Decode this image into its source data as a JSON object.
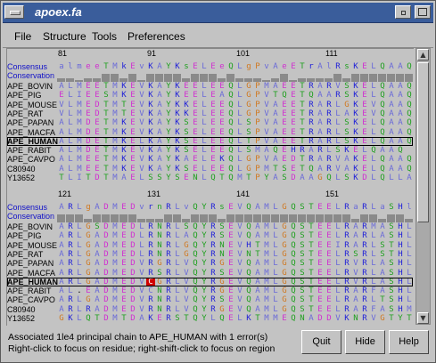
{
  "window": {
    "title": "apoex.fa"
  },
  "menu": [
    "File",
    "Structure",
    "Tools",
    "Preferences"
  ],
  "blocks": [
    {
      "positions": [
        "81",
        "91",
        "101",
        "111"
      ],
      "consensus": "almeeTMkEvKAYKsELEeQLgPvAeETrAlRsKELQAAQ",
      "conservation": [
        4,
        4,
        2,
        4,
        4,
        9,
        9,
        4,
        9,
        2,
        9,
        9,
        9,
        9,
        4,
        9,
        9,
        9,
        4,
        9,
        4,
        4,
        4,
        2,
        4,
        9,
        2,
        4,
        4,
        4,
        4,
        9,
        4,
        9,
        9,
        9,
        9,
        9,
        9,
        9
      ],
      "rows": [
        {
          "name": "APE_BOVIN",
          "seq": "ALMEETMKEVKAYKEELEEQLGPMAEETRARVSKELQAAQ",
          "bold": false
        },
        {
          "name": "APE_PIG",
          "seq": "ELIEESMKEVKAYKEELEAQLGPVTQETQAARSKELQAAQ",
          "bold": false
        },
        {
          "name": "APE_MOUSE",
          "seq": "VLMEDTMTEVKAYKKELEEQLGPVAEETRARLGKEVQAAQ",
          "bold": false
        },
        {
          "name": "APE_RAT",
          "seq": "VLMEDTMTEVKAYKKELEEQLGPVAEETRARLAKEVQAAQ",
          "bold": false
        },
        {
          "name": "APE_PAPAN",
          "seq": "ALMDETMKEVKAYKSELEEQLSPVAEETRARLSKELQAAQ",
          "bold": false
        },
        {
          "name": "APE_MACFA",
          "seq": "ALMDETMKEVKAYKSELEEQLSPVAEETRARLSKELQAAQ",
          "bold": false
        },
        {
          "name": "APE_HUMAN",
          "seq": "ALMDETMKELKAYKSELEEQLTPVAEETRARLSKELQAAQ",
          "bold": true
        },
        {
          "name": "APE_RABIT",
          "seq": "ALMDETMKEVKAYKSELEEQLSMAQEHRARLSKELQAAQ",
          "bold": false
        },
        {
          "name": "APE_CAVPO",
          "seq": "ALMEETMKEVKAYKAELEKQLGPVAEDTRARVAKELQAAQ",
          "bold": false
        },
        {
          "name": "C80940",
          "seq": "ALMEETMKEVKAYKSELEEQLGPMTSETQARVAKELQAAQ",
          "bold": false
        },
        {
          "name": "Y13652",
          "seq": "TLITDTMAELSSYSENLQTQMTPYASDAAGQLSKDLQLLA",
          "bold": false
        }
      ]
    },
    {
      "positions": [
        "121",
        "131",
        "141",
        "151"
      ],
      "consensus": "ARLgADMEDvrnRLvQYRsEVQAMLGQSTEELRaRLaSHl",
      "conservation": [
        9,
        9,
        9,
        4,
        9,
        9,
        9,
        9,
        9,
        4,
        4,
        4,
        9,
        9,
        4,
        9,
        9,
        9,
        4,
        9,
        9,
        9,
        9,
        9,
        9,
        9,
        9,
        9,
        9,
        9,
        9,
        9,
        9,
        4,
        9,
        9,
        4,
        9,
        9,
        4
      ],
      "rows": [
        {
          "name": "APE_BOVIN",
          "seq": "ARLGSDMEDLRNRLSQYRSEVQAMLGQSTEELRARMASHL",
          "bold": false
        },
        {
          "name": "APE_PIG",
          "seq": "ARLGADMEDLRNRLAQYRSEVQAMLGQSTEELRARLASHL",
          "bold": false
        },
        {
          "name": "APE_MOUSE",
          "seq": "ARLGADMEDLRNRLGQYRNEVHTMLGQSTEEIRARLSTHL",
          "bold": false
        },
        {
          "name": "APE_RAT",
          "seq": "ARLGADMEDLRNRLGQYRNEVNTMLGQSTEELRSRLSTHL",
          "bold": false
        },
        {
          "name": "APE_PAPAN",
          "seq": "ARLGADMEDVRGRLVQYRGEVQAMLGQSTEELRVRLASHL",
          "bold": false
        },
        {
          "name": "APE_MACFA",
          "seq": "ARLGADMEDVRSRLVQYRSEVQAMLGQSTEELRVRLASHL",
          "bold": false
        },
        {
          "name": "APE_HUMAN",
          "seq": "ARLGADMEDVCGRLVQYRGEVQAMLGQSTEELRVRLASHL",
          "bold": true
        },
        {
          "name": "APE_RABIT",
          "seq": "AL.EADMEDVCNRLVQYRGEVQAMLGQSTEELRARFASHL",
          "bold": false
        },
        {
          "name": "APE_CAVPO",
          "seq": "ARLGADMEDVRNRLVQYRSEVQAMLGQSTEELRARLTSHL",
          "bold": false
        },
        {
          "name": "C80940",
          "seq": "ARLRADMEDVRNRLVQYRGEVQAMLGQSTEELRARFASHM",
          "bold": false
        },
        {
          "name": "Y13652",
          "seq": "GKLQTDMTDAKERSTQYLQELKTMMEQNADDVKNRVGTYT",
          "bold": false
        }
      ]
    }
  ],
  "labels": {
    "consensus": "Consensus",
    "conservation": "Conservation"
  },
  "status": {
    "line1": "Associated 1le4 principal chain to APE_HUMAN with 1 error(s)",
    "line2": "Right-click to focus on residue; right-shift-click to focus on region"
  },
  "buttons": {
    "quit": "Quit",
    "hide": "Hide",
    "help": "Help"
  },
  "colors": {
    "hydrophobic": "#6a6ad8",
    "charged_pos": "#2020d8",
    "charged_neg": "#d030d0",
    "polar": "#20a020",
    "glycine_proline": "#d07820",
    "error_highlight": "#d00000"
  }
}
